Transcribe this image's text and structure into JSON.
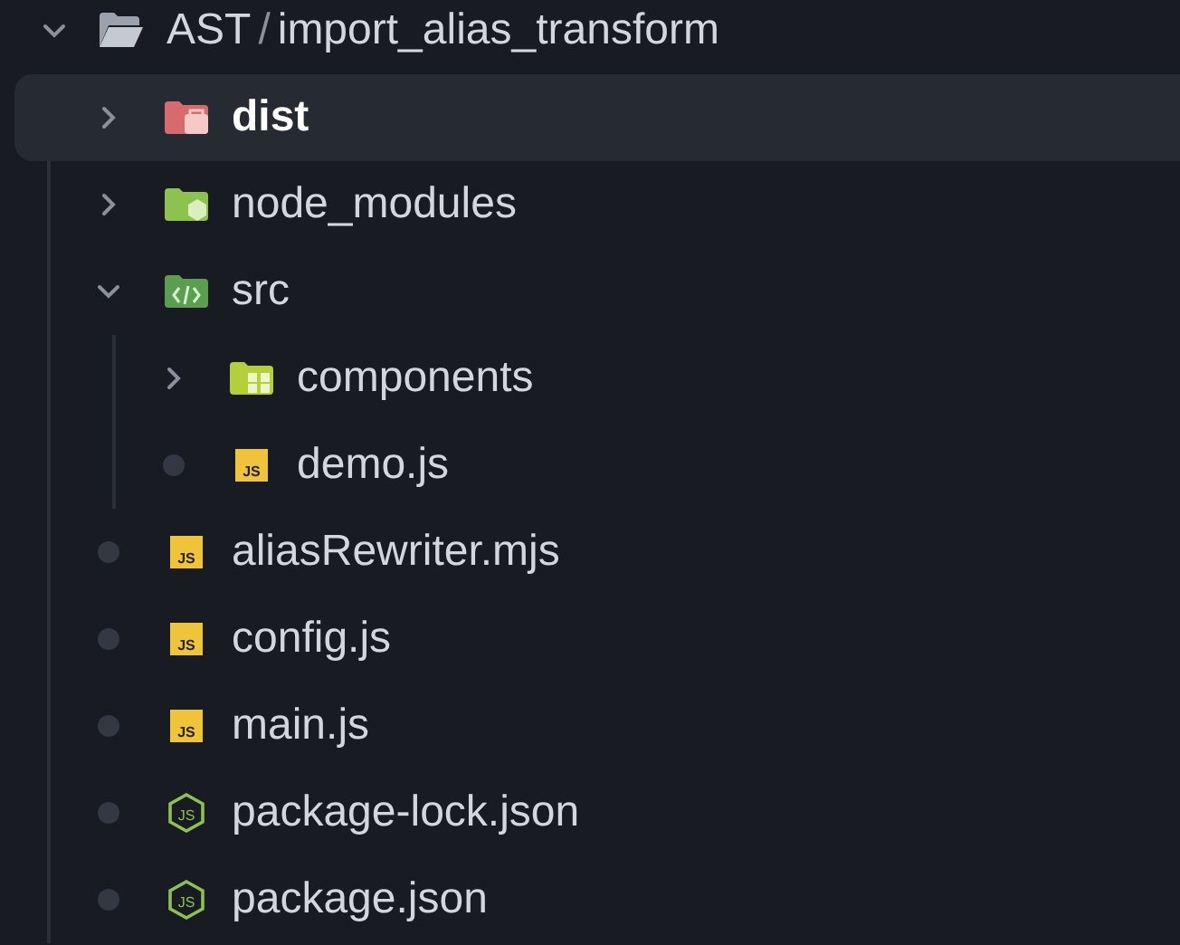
{
  "root": {
    "name": "AST",
    "separator": "/",
    "path": "import_alias_transform",
    "expanded": true,
    "children": [
      {
        "kind": "folder-dist",
        "name": "dist",
        "expanded": false,
        "selected": true
      },
      {
        "kind": "folder-node",
        "name": "node_modules",
        "expanded": false,
        "selected": false
      },
      {
        "kind": "folder-src",
        "name": "src",
        "expanded": true,
        "selected": false,
        "children": [
          {
            "kind": "folder-components",
            "name": "components",
            "expanded": false,
            "selected": false
          },
          {
            "kind": "js",
            "name": "demo.js",
            "icon_text": "JS",
            "selected": false
          }
        ]
      },
      {
        "kind": "js",
        "name": "aliasRewriter.mjs",
        "icon_text": "JS",
        "selected": false
      },
      {
        "kind": "js",
        "name": "config.js",
        "icon_text": "JS",
        "selected": false
      },
      {
        "kind": "js",
        "name": "main.js",
        "icon_text": "JS",
        "selected": false
      },
      {
        "kind": "node-json",
        "name": "package-lock.json",
        "icon_text": "JS",
        "selected": false
      },
      {
        "kind": "node-json",
        "name": "package.json",
        "icon_text": "JS",
        "selected": false
      }
    ]
  }
}
